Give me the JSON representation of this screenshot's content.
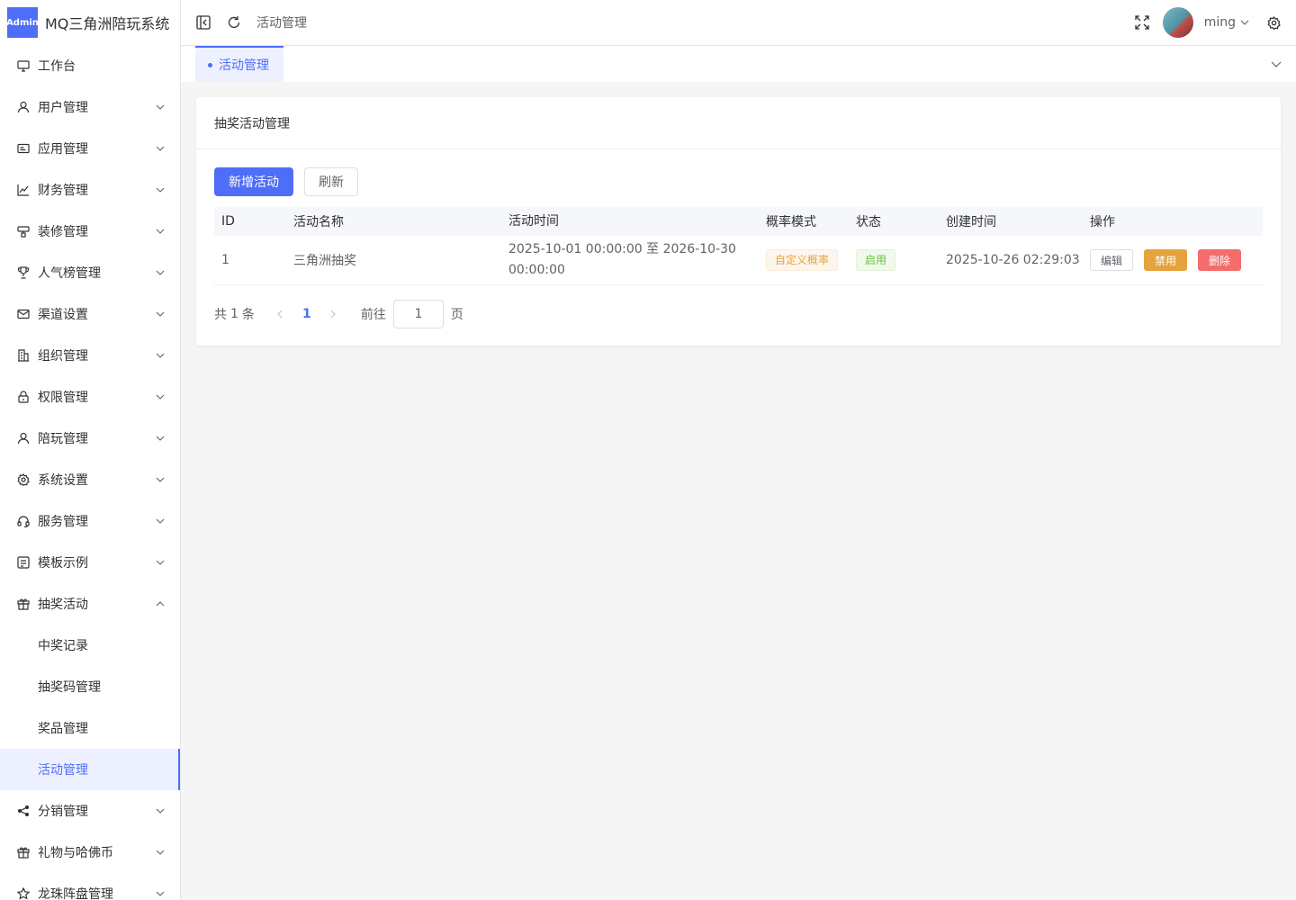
{
  "app": {
    "logo_badge": "Admin",
    "title": "MQ三角洲陪玩系统"
  },
  "sidebar": {
    "items": [
      {
        "label": "工作台",
        "icon": "monitor-icon"
      },
      {
        "label": "用户管理",
        "icon": "user-icon"
      },
      {
        "label": "应用管理",
        "icon": "app-icon"
      },
      {
        "label": "财务管理",
        "icon": "chart-icon"
      },
      {
        "label": "装修管理",
        "icon": "decor-icon"
      },
      {
        "label": "人气榜管理",
        "icon": "trophy-icon"
      },
      {
        "label": "渠道设置",
        "icon": "mail-icon"
      },
      {
        "label": "组织管理",
        "icon": "building-icon"
      },
      {
        "label": "权限管理",
        "icon": "lock-icon"
      },
      {
        "label": "陪玩管理",
        "icon": "user-icon"
      },
      {
        "label": "系统设置",
        "icon": "gear-icon"
      },
      {
        "label": "服务管理",
        "icon": "headset-icon"
      },
      {
        "label": "模板示例",
        "icon": "template-icon"
      },
      {
        "label": "抽奖活动",
        "icon": "gift-icon"
      },
      {
        "label": "中奖记录"
      },
      {
        "label": "抽奖码管理"
      },
      {
        "label": "奖品管理"
      },
      {
        "label": "活动管理"
      },
      {
        "label": "分销管理",
        "icon": "share-icon"
      },
      {
        "label": "礼物与哈佛币",
        "icon": "gift-icon"
      },
      {
        "label": "龙珠阵盘管理",
        "icon": "star-icon"
      }
    ]
  },
  "header": {
    "breadcrumb": "活动管理",
    "username": "ming"
  },
  "tabs": [
    {
      "label": "活动管理"
    }
  ],
  "card": {
    "title": "抽奖活动管理",
    "add_button": "新增活动",
    "refresh_button": "刷新"
  },
  "table": {
    "headers": {
      "id": "ID",
      "name": "活动名称",
      "time": "活动时间",
      "mode": "概率模式",
      "status": "状态",
      "created": "创建时间",
      "ops": "操作"
    },
    "rows": [
      {
        "id": "1",
        "name": "三角洲抽奖",
        "time": "2025-10-01 00:00:00 至 2026-10-30 00:00:00",
        "mode": "自定义概率",
        "status": "启用",
        "created": "2025-10-26 02:29:03",
        "edit": "编辑",
        "disable": "禁用",
        "delete": "删除"
      }
    ]
  },
  "pagination": {
    "total_prefix": "共",
    "total": "1",
    "total_suffix": "条",
    "current_page": "1",
    "goto_label": "前往",
    "goto_value": "1",
    "page_suffix": "页"
  },
  "colors": {
    "accent": "#4f6ef7",
    "warning": "#e6a23c",
    "danger": "#f56c6c",
    "success": "#67c23a"
  }
}
